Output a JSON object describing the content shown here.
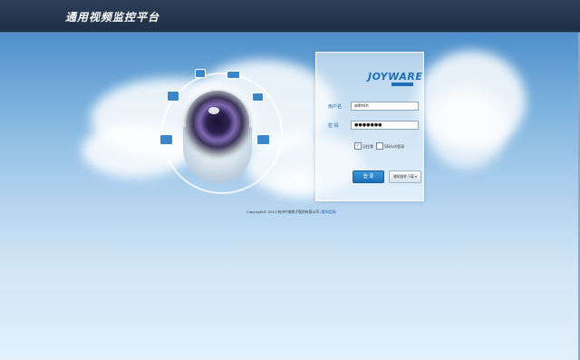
{
  "header": {
    "title": "通用视频监控平台"
  },
  "brand": {
    "logo": "JOYWARE",
    "accent": "#1d6fb5"
  },
  "login": {
    "username_label": "用户名",
    "username_value": "admin",
    "password_label": "密 码",
    "password_value": "●●●●●●●",
    "remember_label": "记住我",
    "remember_checked": true,
    "remember_check": "✓",
    "ssl_label": "SSl/ssh登录",
    "ssl_checked": false,
    "login_button": "登 录",
    "plugin_button": "辅助插件下载",
    "plugin_arrow": "▾"
  },
  "footer": {
    "copyright": "Copyright© 2013 杭州中威电子股份有限公司",
    "link": "(版本信息)"
  },
  "icons": [
    "camera-lens-icon",
    "hand-icon",
    "alarm-icon",
    "car-icon",
    "video-camera-icon",
    "picture-icon",
    "map-icon",
    "monitor-icon",
    "arrow-icon"
  ]
}
